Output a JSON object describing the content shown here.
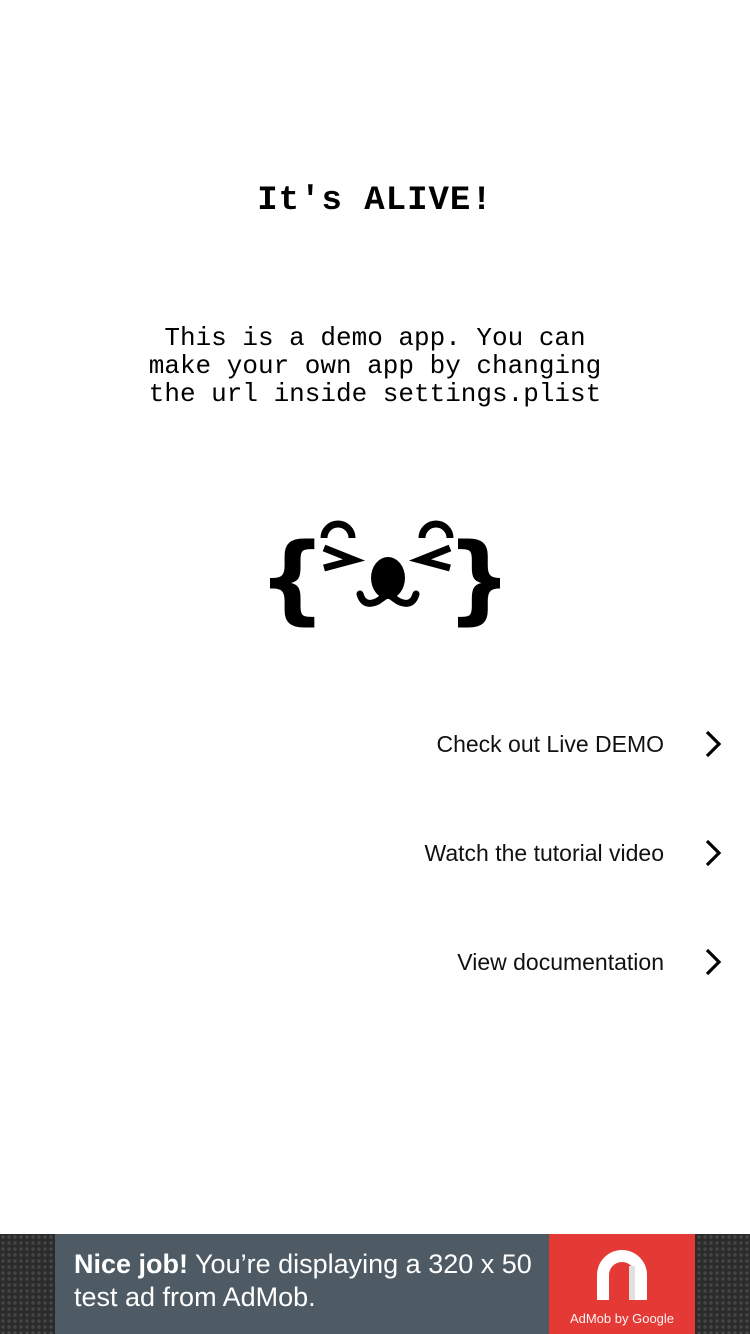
{
  "title": "It's ALIVE!",
  "description": "This is a demo app. You can\nmake your own app by changing\nthe url inside settings.plist",
  "logo": {
    "icon": "jasonette-face-logo-icon"
  },
  "links": [
    {
      "label": "Check out Live DEMO",
      "icon": "chevron-right-icon"
    },
    {
      "label": "Watch the tutorial video",
      "icon": "chevron-right-icon"
    },
    {
      "label": "View documentation",
      "icon": "chevron-right-icon"
    }
  ],
  "ad": {
    "headline": "Nice job!",
    "body_line1": " You’re displaying a 320 x 50",
    "body_line2": "test ad from AdMob.",
    "logo_caption": "AdMob by Google",
    "card_color": "#4e5b64",
    "logo_color": "#e53935"
  }
}
